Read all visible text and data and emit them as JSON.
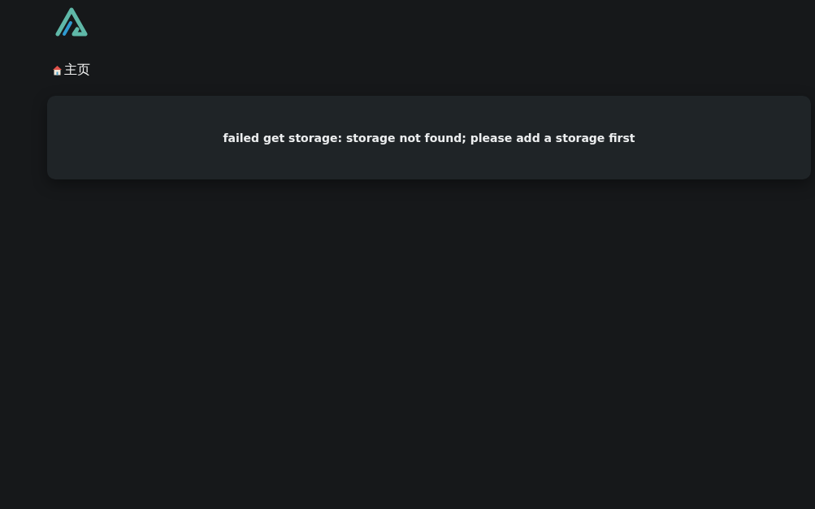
{
  "breadcrumb": {
    "label": "主页"
  },
  "error": {
    "message": "failed get storage: storage not found; please add a storage first"
  }
}
